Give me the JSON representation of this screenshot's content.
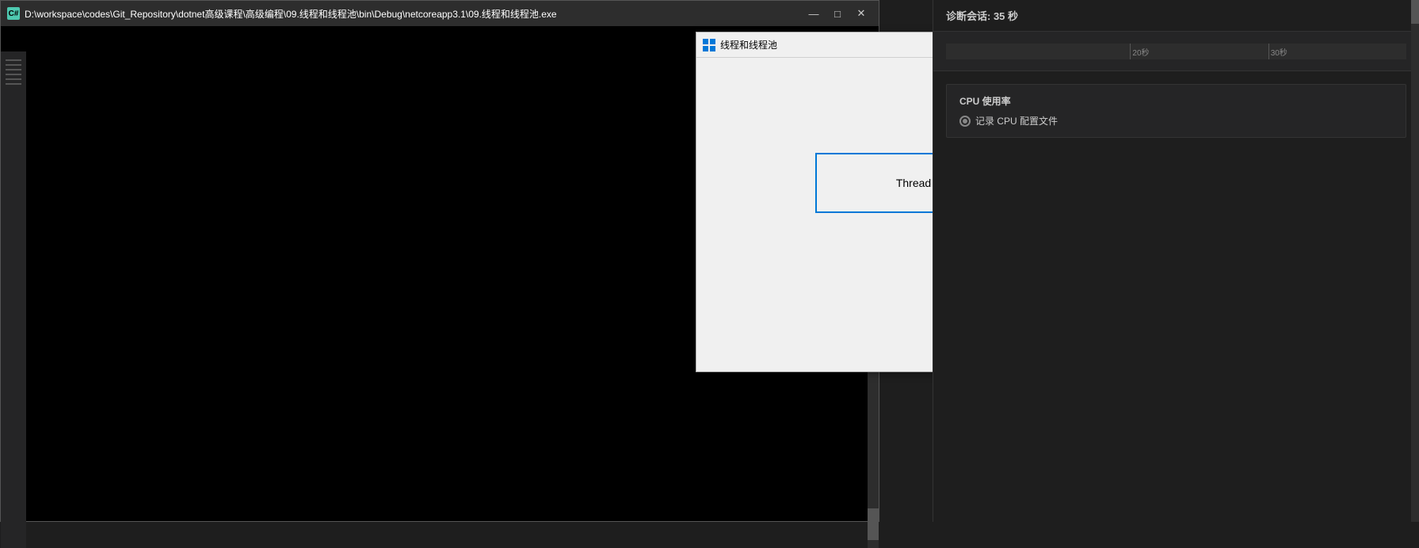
{
  "console": {
    "icon": "C#",
    "title": "D:\\workspace\\codes\\Git_Repository\\dotnet高级课程\\高级编程\\09.线程和线程池\\bin\\Debug\\netcoreapp3.1\\09.线程和线程池.exe",
    "minimize": "—",
    "maximize": "□",
    "close": "✕",
    "controls": {
      "minimize": "—",
      "maximize": "□",
      "close": "✕"
    }
  },
  "winforms": {
    "icon_label": "■■",
    "title": "线程和线程池",
    "minimize": "—",
    "maximize": "□",
    "close": "✕",
    "thread_button_label": "Thread"
  },
  "diagnostics": {
    "session_label": "诊断会话: 35 秒",
    "timeline": {
      "tick1_label": "20秒",
      "tick2_label": "30秒"
    },
    "cpu_section": {
      "title": "CPU 使用率",
      "option_label": "记录 CPU 配置文件"
    }
  }
}
